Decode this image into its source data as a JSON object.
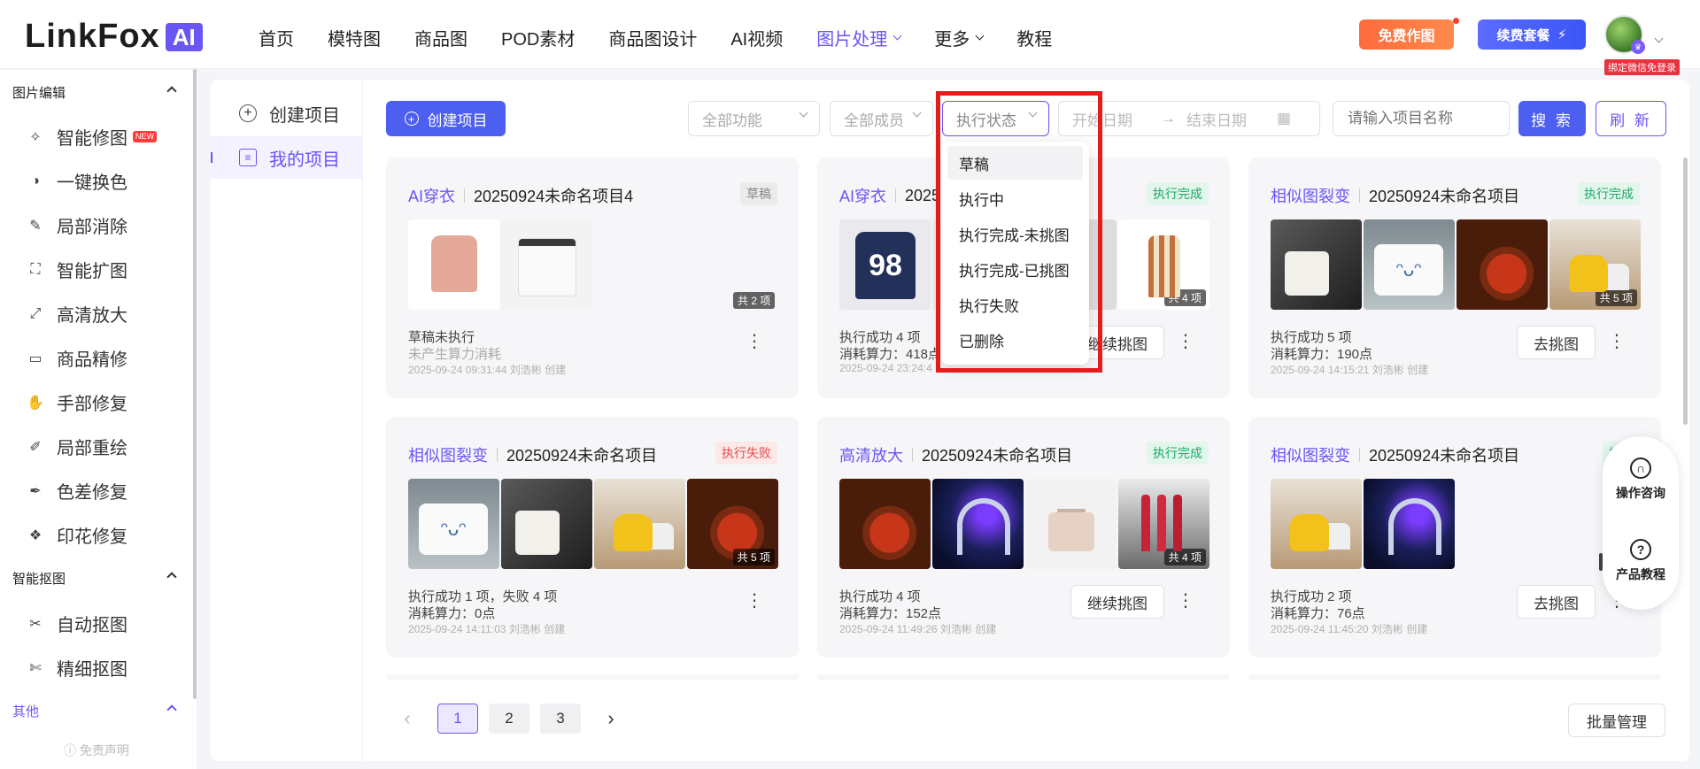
{
  "app": {
    "logo_text": "LinkFox",
    "logo_badge": "AI"
  },
  "nav": {
    "items": [
      {
        "label": "首页"
      },
      {
        "label": "模特图"
      },
      {
        "label": "商品图"
      },
      {
        "label": "POD素材"
      },
      {
        "label": "商品图设计"
      },
      {
        "label": "AI视频"
      },
      {
        "label": "图片处理",
        "active": true
      },
      {
        "label": "更多"
      },
      {
        "label": "教程"
      }
    ],
    "free_button": "免费作图",
    "plan_button": "续费套餐",
    "plan_icon": "⚡",
    "bind_wechat": "绑定微信免登录",
    "accent_color": "#6a55f5"
  },
  "sidebar": {
    "group_image_edit": "图片编辑",
    "group_cutout": "智能抠图",
    "group_other": "其他",
    "new_badge": "NEW",
    "items_edit": [
      {
        "label": "智能修图",
        "icon": "magic-wand-icon"
      },
      {
        "label": "一键换色",
        "icon": "color-swap-icon"
      },
      {
        "label": "局部消除",
        "icon": "eraser-icon"
      },
      {
        "label": "智能扩图",
        "icon": "expand-icon"
      },
      {
        "label": "高清放大",
        "icon": "upscale-icon"
      },
      {
        "label": "商品精修",
        "icon": "retouch-icon"
      },
      {
        "label": "手部修复",
        "icon": "hand-icon"
      },
      {
        "label": "局部重绘",
        "icon": "repaint-icon"
      },
      {
        "label": "色差修复",
        "icon": "color-pick-icon"
      },
      {
        "label": "印花修复",
        "icon": "pattern-icon"
      }
    ],
    "items_cutout": [
      {
        "label": "自动抠图",
        "icon": "auto-cutout-icon"
      },
      {
        "label": "精细抠图",
        "icon": "fine-cutout-icon"
      }
    ],
    "disclaimer": "免责声明"
  },
  "subnav": {
    "create": "创建项目",
    "mine": "我的项目"
  },
  "toolbar": {
    "create_button": "创建项目",
    "filter_function": "全部功能",
    "filter_member": "全部成员",
    "filter_status": "执行状态",
    "start_date": "开始日期",
    "end_date": "结束日期",
    "name_placeholder": "请输入项目名称",
    "search": "搜 索",
    "refresh": "刷 新"
  },
  "status_dropdown": {
    "options": [
      "草稿",
      "执行中",
      "执行完成-未挑图",
      "执行完成-已挑图",
      "执行失败",
      "已删除"
    ],
    "hovered_index": 0
  },
  "cards": [
    {
      "type": "AI穿衣",
      "name": "20250924未命名项目4",
      "status": "草稿",
      "status_kind": "draft",
      "thumbs": [
        "sweater",
        "tee"
      ],
      "count": "共 2 项",
      "stat1": "草稿未执行",
      "stat2": "未产生算力消耗",
      "stat2_muted": true,
      "meta": "2025-09-24 09:31:44 刘浩彬 创建",
      "button": ""
    },
    {
      "type": "AI穿衣",
      "name": "2025",
      "status": "执行完成",
      "status_kind": "done",
      "thumbs": [
        "jersey",
        "dress"
      ],
      "count": "共 4 项",
      "stat1": "执行成功 4 项",
      "stat2": "消耗算力：418点",
      "stat2_muted": false,
      "meta": "2025-09-24 23:24:4",
      "button": "继续挑图"
    },
    {
      "type": "相似图裂变",
      "name": "20250924未命名项目",
      "status": "执行完成",
      "status_kind": "done",
      "thumbs": [
        "mug-black",
        "mug-smile",
        "tea",
        "kettle"
      ],
      "count": "共 5 项",
      "stat1": "执行成功 5 项",
      "stat2": "消耗算力：190点",
      "stat2_muted": false,
      "meta": "2025-09-24 14:15:21 刘浩彬 创建",
      "button": "去挑图"
    },
    {
      "type": "相似图裂变",
      "name": "20250924未命名项目",
      "status": "执行失败",
      "status_kind": "fail",
      "thumbs": [
        "mug-smile",
        "mug-black",
        "kettle",
        "tea"
      ],
      "count": "共 5 项",
      "stat1": "执行成功 1 项，失败 4 项",
      "stat2": "消耗算力：0点",
      "stat2_muted": false,
      "meta": "2025-09-24 14:11:03 刘浩彬 创建",
      "button": ""
    },
    {
      "type": "高清放大",
      "name": "20250924未命名项目",
      "status": "执行完成",
      "status_kind": "done",
      "thumbs": [
        "tea",
        "headphone",
        "bag",
        "lipstick"
      ],
      "count": "共 4 项",
      "stat1": "执行成功 4 项",
      "stat2": "消耗算力：152点",
      "stat2_muted": false,
      "meta": "2025-09-24 11:49:26 刘浩彬 创建",
      "button": "继续挑图"
    },
    {
      "type": "相似图裂变",
      "name": "20250924未命名项目",
      "status": "执行",
      "status_kind": "done",
      "thumbs": [
        "kettle",
        "headphone"
      ],
      "count": "",
      "stat1": "执行成功 2 项",
      "stat2": "消耗算力：76点",
      "stat2_muted": false,
      "meta": "2025-09-24 11:45:20 刘浩彬 创建",
      "button": "去挑图"
    }
  ],
  "floating_help": {
    "consult": "操作咨询",
    "tutorial": "产品教程"
  },
  "pagination": {
    "pages": [
      "1",
      "2",
      "3"
    ],
    "current": "1",
    "prev": "‹",
    "next": "›",
    "batch": "批量管理"
  }
}
